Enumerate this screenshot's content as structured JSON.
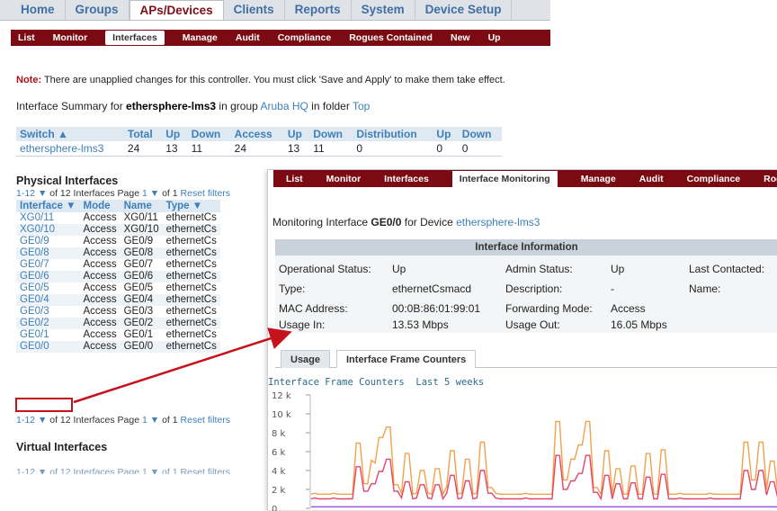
{
  "main_nav": {
    "tabs": [
      "Home",
      "Groups",
      "APs/Devices",
      "Clients",
      "Reports",
      "System",
      "Device Setup"
    ],
    "active": "APs/Devices"
  },
  "sub_nav": {
    "tabs": [
      "List",
      "Monitor",
      "Interfaces",
      "Manage",
      "Audit",
      "Compliance",
      "Rogues Contained",
      "New",
      "Up"
    ],
    "active": "Interfaces"
  },
  "note": {
    "label": "Note:",
    "text": " There are unapplied changes for this controller. You must click 'Save and Apply' to make them take effect."
  },
  "summary": {
    "prefix": "Interface Summary for ",
    "device": "ethersphere-lms3",
    "mid": " in group ",
    "group": "Aruba HQ",
    "mid2": " in folder ",
    "folder": "Top"
  },
  "switch_table": {
    "headers": [
      "Switch ▲",
      "Total",
      "Up",
      "Down",
      "Access",
      "Up",
      "Down",
      "Distribution",
      "Up",
      "Down"
    ],
    "row": [
      "ethersphere-lms3",
      "24",
      "13",
      "11",
      "24",
      "13",
      "11",
      "0",
      "0",
      "0"
    ]
  },
  "physical": {
    "title": "Physical Interfaces",
    "pager_top": {
      "range": "1-12",
      "arrow": "▼",
      "of_text": " of 12 Interfaces  Page ",
      "page": "1",
      "page_of": " of 1 ",
      "reset": "Reset filters"
    },
    "headers": [
      "Interface ▼",
      "Mode",
      "Name",
      "Type ▼"
    ],
    "rows": [
      [
        "XG0/11",
        "Access",
        "XG0/11",
        "ethernetCs"
      ],
      [
        "XG0/10",
        "Access",
        "XG0/10",
        "ethernetCs"
      ],
      [
        "GE0/9",
        "Access",
        "GE0/9",
        "ethernetCs"
      ],
      [
        "GE0/8",
        "Access",
        "GE0/8",
        "ethernetCs"
      ],
      [
        "GE0/7",
        "Access",
        "GE0/7",
        "ethernetCs"
      ],
      [
        "GE0/6",
        "Access",
        "GE0/6",
        "ethernetCs"
      ],
      [
        "GE0/5",
        "Access",
        "GE0/5",
        "ethernetCs"
      ],
      [
        "GE0/4",
        "Access",
        "GE0/4",
        "ethernetCs"
      ],
      [
        "GE0/3",
        "Access",
        "GE0/3",
        "ethernetCs"
      ],
      [
        "GE0/2",
        "Access",
        "GE0/2",
        "ethernetCs"
      ],
      [
        "GE0/1",
        "Access",
        "GE0/1",
        "ethernetCs"
      ],
      [
        "GE0/0",
        "Access",
        "GE0/0",
        "ethernetCs"
      ]
    ]
  },
  "virtual": {
    "title": "Virtual Interfaces",
    "pager_text": "1-12 ▼ of 12 Interfaces  Page 1 ▼ of 1 Reset filters"
  },
  "overlay": {
    "sub_nav": [
      "List",
      "Monitor",
      "Interfaces",
      "Interface Monitoring",
      "Manage",
      "Audit",
      "Compliance",
      "Rog"
    ],
    "active": "Interface Monitoring",
    "title_prefix": "Monitoring Interface ",
    "interface": "GE0/0",
    "title_mid": " for Device ",
    "device": "ethersphere-lms3",
    "info_header": "Interface Information",
    "info": {
      "op_status_label": "Operational Status:",
      "op_status": "Up",
      "admin_status_label": "Admin Status:",
      "admin_status": "Up",
      "last_contacted_label": "Last Contacted:",
      "type_label": "Type:",
      "type": "ethernetCsmacd",
      "description_label": "Description:",
      "description": "-",
      "name_label": "Name:",
      "mac_label": "MAC Address:",
      "mac": "00:0B:86:01:99:01",
      "fwd_label": "Forwarding Mode:",
      "fwd": "Access",
      "usage_in_label": "Usage In:",
      "usage_in": "13.53 Mbps",
      "usage_out_label": "Usage Out:",
      "usage_out": "16.05 Mbps"
    },
    "tabs": [
      "Usage",
      "Interface Frame Counters"
    ],
    "active_tab": "Interface Frame Counters",
    "chart_title": "Interface Frame Counters",
    "chart_range": "Last 5 weeks"
  },
  "colors": {
    "nav_active_text": "#7b0e16",
    "subnav_bg": "#7c0a12",
    "link": "#3f7fb9",
    "series_orange": "#f0a34a",
    "series_red": "#e6456b",
    "series_purple": "#9a59d6",
    "highlight": "#c6121d"
  },
  "chart_data": {
    "type": "line",
    "title": "Interface Frame Counters",
    "subtitle": "Last 5 weeks",
    "ylim": [
      0,
      12000
    ],
    "y_ticks": [
      "12 k",
      "10 k",
      "8 k",
      "6 k",
      "4 k",
      "2 k",
      "0"
    ],
    "series": [
      {
        "values": [
          1500,
          1600,
          1500,
          1500,
          1500,
          1500,
          1600,
          1500,
          1500,
          1500,
          1500,
          1500,
          6900,
          6900,
          2600,
          2600,
          5100,
          4800,
          7500,
          7500,
          8600,
          8600,
          2500,
          2500,
          1600,
          5800,
          5800,
          1500,
          1600,
          4000,
          4000,
          1600,
          1500,
          4200,
          4200,
          1500,
          2300,
          6100,
          6100,
          1500,
          1600,
          5200,
          5200,
          1500,
          1600,
          7000,
          7000,
          2200,
          2200,
          1600,
          1500,
          1500,
          1500,
          1500,
          1500,
          1500,
          1500,
          1600,
          1500,
          1500,
          1500,
          1500,
          1500,
          1500,
          1500,
          9200,
          9200,
          3000,
          3000,
          5200,
          5200,
          6700,
          6700,
          9200,
          9200,
          2200,
          2200,
          1500,
          6100,
          6100,
          1500,
          4200,
          4200,
          1500,
          1500,
          4500,
          4500,
          1500,
          1500,
          5800,
          5800,
          1500,
          1500,
          6200,
          6200,
          1500,
          1500,
          1500,
          1600,
          1500,
          1500,
          1500,
          1500,
          1500,
          1500,
          1500,
          1600,
          1500,
          1500,
          1500,
          1500,
          1500,
          1500,
          1500,
          1500,
          7000,
          7000,
          3000,
          3000,
          7000,
          7000,
          2000,
          5000,
          5000,
          1500
        ]
      },
      {
        "values": [
          1000,
          1100,
          1000,
          1000,
          1000,
          1000,
          1100,
          1000,
          1000,
          1000,
          1000,
          1000,
          4400,
          4400,
          1800,
          1800,
          2600,
          2600,
          3900,
          3900,
          5200,
          5200,
          1800,
          1800,
          1100,
          2800,
          2800,
          1000,
          1100,
          2500,
          2500,
          1100,
          1000,
          2500,
          2500,
          1000,
          1600,
          3500,
          3500,
          1000,
          1100,
          2900,
          2900,
          1000,
          1100,
          4000,
          4000,
          1600,
          1600,
          1100,
          1000,
          1000,
          1000,
          1000,
          1000,
          1000,
          1000,
          1100,
          1000,
          1000,
          1000,
          1000,
          1000,
          1000,
          1000,
          5600,
          5600,
          2000,
          2000,
          2900,
          2900,
          3700,
          3700,
          5600,
          5600,
          1700,
          1700,
          1000,
          3500,
          3500,
          1000,
          2600,
          2600,
          1000,
          1000,
          2700,
          2700,
          1000,
          1000,
          3300,
          3300,
          1000,
          1000,
          3600,
          3600,
          1000,
          1000,
          1000,
          1100,
          1000,
          1000,
          1000,
          1000,
          1000,
          1000,
          1000,
          1100,
          1000,
          1000,
          1000,
          1000,
          1000,
          1000,
          1000,
          1000,
          4000,
          4000,
          2000,
          2000,
          4000,
          4000,
          1400,
          2800,
          2800,
          1000
        ]
      },
      {
        "values": [
          150,
          150,
          150,
          150,
          150,
          150,
          150,
          150,
          150,
          150,
          150,
          150,
          150,
          150,
          150,
          150,
          150,
          150,
          150,
          150,
          150,
          150,
          150,
          150,
          150,
          150,
          150,
          150,
          150,
          150,
          150,
          150,
          150,
          150,
          150,
          150,
          150,
          150,
          150,
          150,
          150,
          150,
          150,
          150,
          150,
          150,
          150,
          150,
          150,
          150,
          150,
          150,
          150,
          150,
          150,
          150,
          150,
          150,
          150,
          150,
          150,
          150,
          150,
          150,
          150,
          150,
          150,
          150,
          150,
          150,
          150,
          150,
          150,
          150,
          150,
          150,
          150,
          150,
          150,
          150,
          150,
          150,
          150,
          150,
          150,
          150,
          150,
          150,
          150,
          150,
          150,
          150,
          150,
          150,
          150,
          150,
          150,
          150,
          150,
          150,
          150,
          150,
          150,
          150,
          150,
          150,
          150,
          150,
          150,
          150,
          150,
          150,
          150,
          150,
          150,
          150,
          150,
          150,
          150,
          150,
          150,
          150,
          150,
          150,
          150
        ]
      }
    ]
  }
}
